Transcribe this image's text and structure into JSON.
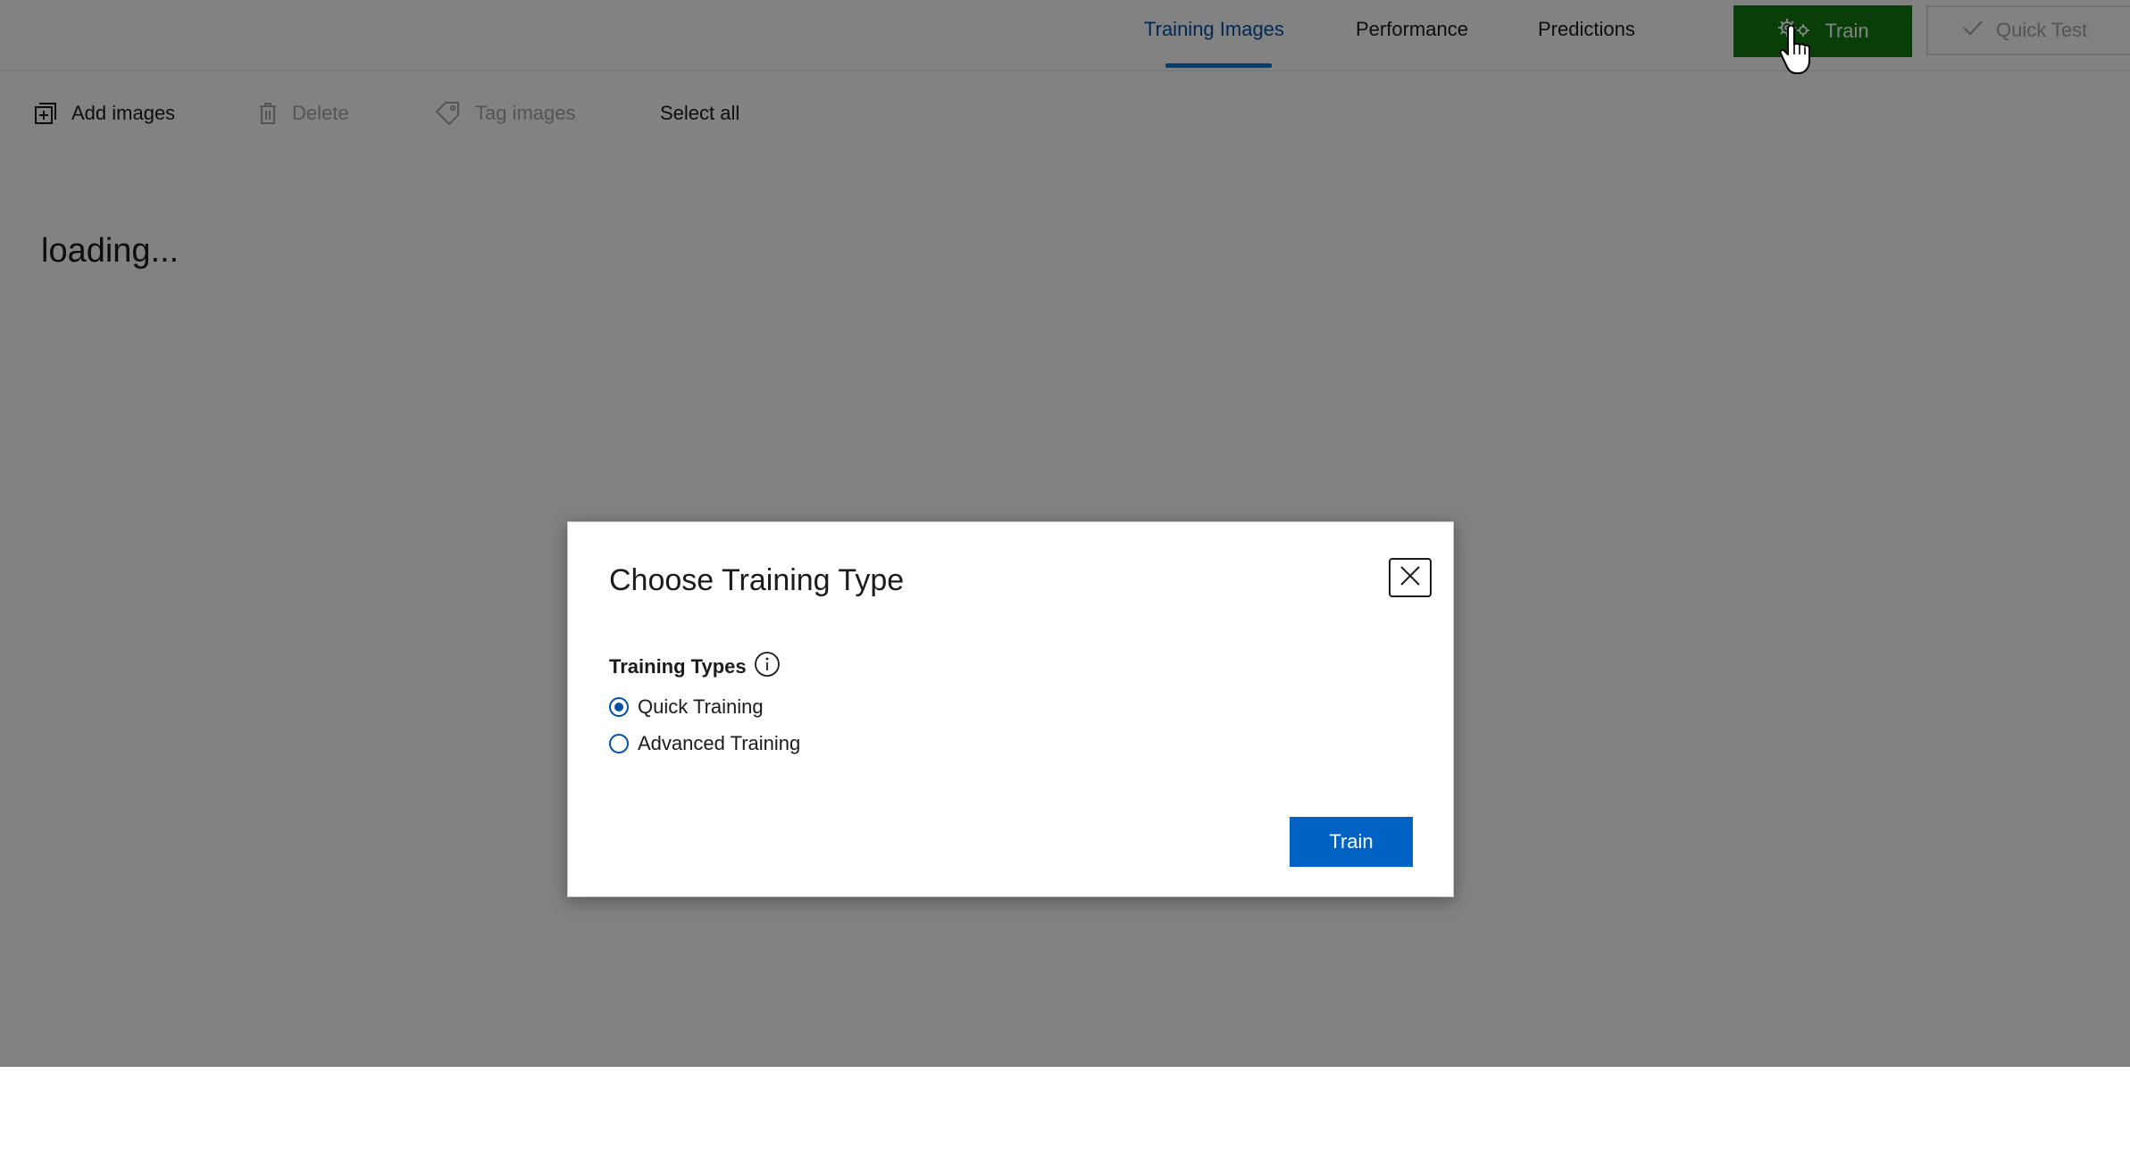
{
  "nav": {
    "tabs": [
      {
        "label": "Training Images",
        "active": true
      },
      {
        "label": "Performance",
        "active": false
      },
      {
        "label": "Predictions",
        "active": false
      }
    ],
    "train_label": "Train",
    "quick_test_label": "Quick Test"
  },
  "toolbar": {
    "add_images": "Add images",
    "delete": "Delete",
    "tag_images": "Tag images",
    "select_all": "Select all"
  },
  "main": {
    "status_text": "loading..."
  },
  "dialog": {
    "title": "Choose Training Type",
    "field_label": "Training Types",
    "options": [
      {
        "label": "Quick Training",
        "selected": true
      },
      {
        "label": "Advanced Training",
        "selected": false
      }
    ],
    "train_button": "Train"
  },
  "colors": {
    "train_green": "#107c10",
    "primary_blue": "#0063c4",
    "active_tab": "#0050a8",
    "overlay": "rgba(0,0,0,0.49)"
  },
  "icons": {
    "train": "gears-icon",
    "quick_test": "checkmark-icon",
    "add_images": "add-image-icon",
    "delete": "trash-icon",
    "tag_images": "tag-icon",
    "info": "info-icon",
    "close": "close-icon",
    "cursor": "hand-pointer-icon"
  }
}
